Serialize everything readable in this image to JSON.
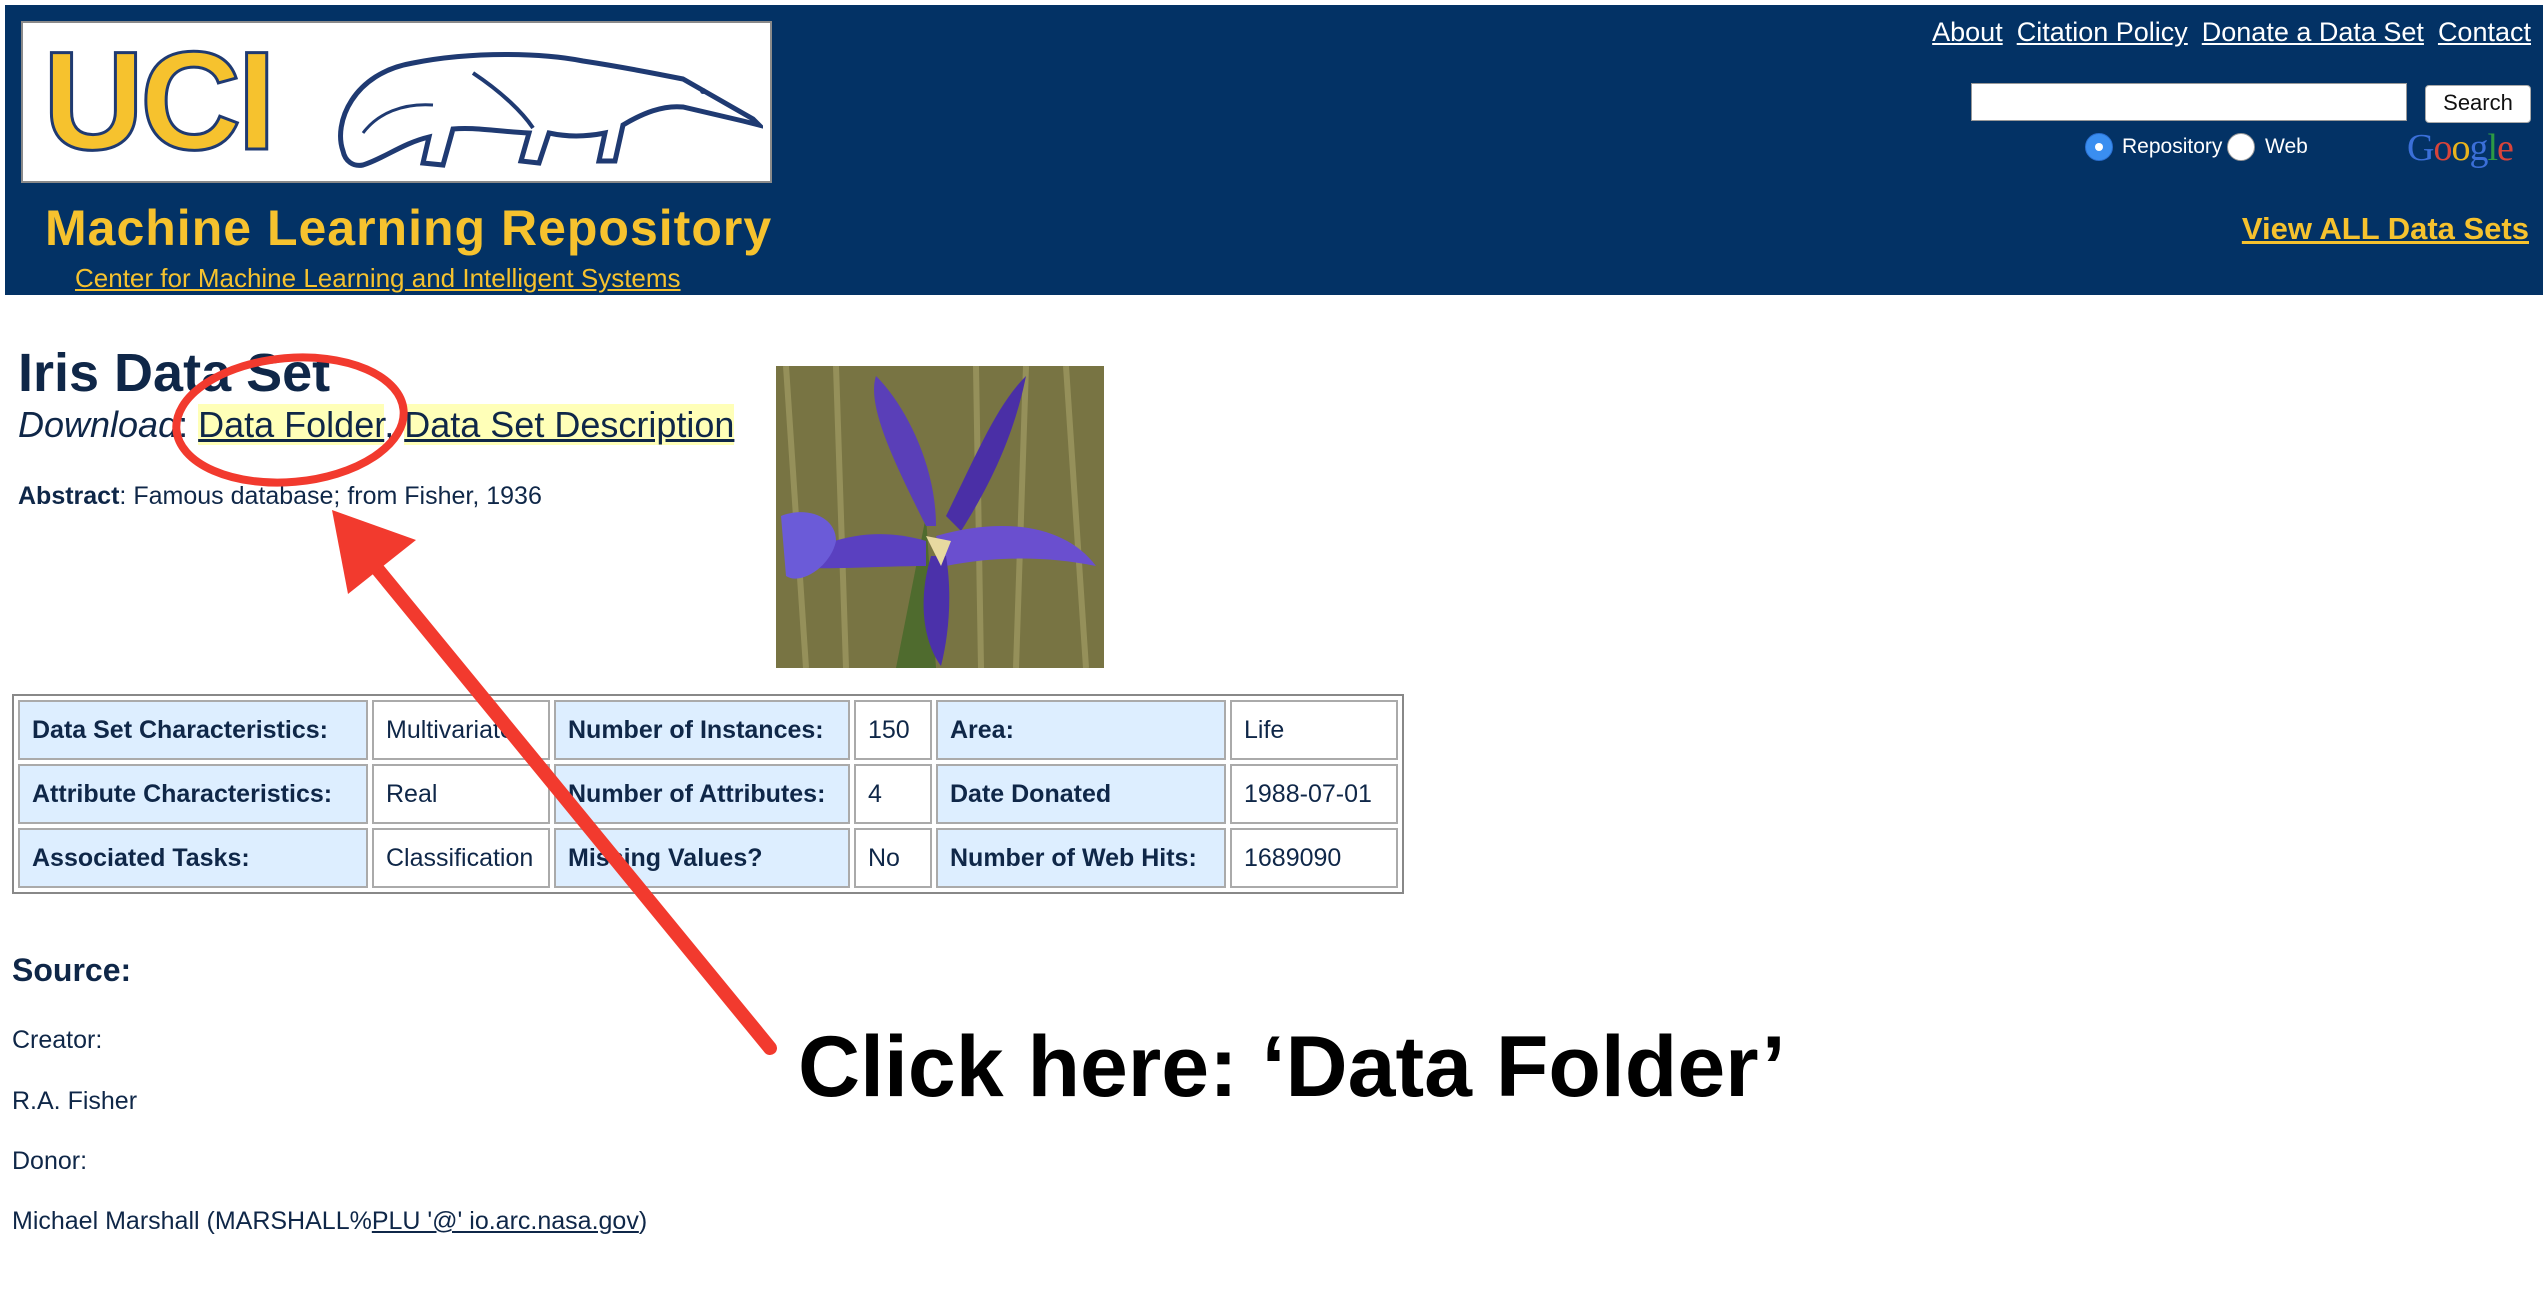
{
  "header": {
    "logo_text": "UCI",
    "repo_title": "Machine Learning Repository",
    "center_link": "Center for Machine Learning and Intelligent Systems",
    "nav": [
      "About",
      "Citation Policy",
      "Donate a Data Set",
      "Contact"
    ],
    "search": {
      "value": "",
      "button_label": "Search"
    },
    "radio_options": [
      {
        "label": "Repository",
        "selected": true
      },
      {
        "label": "Web",
        "selected": false
      }
    ],
    "google_logo": "Google",
    "view_all": "View ALL Data Sets",
    "colors": {
      "bar": "#033265",
      "accent": "#f6c22e"
    }
  },
  "dataset": {
    "title": "Iris Data Set",
    "download_label": "Download",
    "download_links": [
      "Data Folder",
      "Data Set Description"
    ],
    "abstract_label": "Abstract",
    "abstract_text": ": Famous database; from Fisher, 1936",
    "image": "iris-flower-photo",
    "table": [
      [
        {
          "k": "Data Set Characteristics:",
          "v": "Multivariate"
        },
        {
          "k": "Number of Instances:",
          "v": "150"
        },
        {
          "k": "Area:",
          "v": "Life"
        }
      ],
      [
        {
          "k": "Attribute Characteristics:",
          "v": "Real"
        },
        {
          "k": "Number of Attributes:",
          "v": "4"
        },
        {
          "k": "Date Donated",
          "v": "1988-07-01"
        }
      ],
      [
        {
          "k": "Associated Tasks:",
          "v": "Classification"
        },
        {
          "k": "Missing Values?",
          "v": "No"
        },
        {
          "k": "Number of Web Hits:",
          "v": "1689090"
        }
      ]
    ]
  },
  "source": {
    "heading": "Source:",
    "creator_label": "Creator:",
    "creator_name": "R.A. Fisher",
    "donor_label": "Donor:",
    "donor_prefix": "Michael Marshall (MARSHALL%",
    "donor_link": "PLU '@' io.arc.nasa.gov",
    "donor_suffix": ")"
  },
  "annotation": {
    "text": "Click here: ‘Data Folder’",
    "color": "#f23a2e"
  }
}
